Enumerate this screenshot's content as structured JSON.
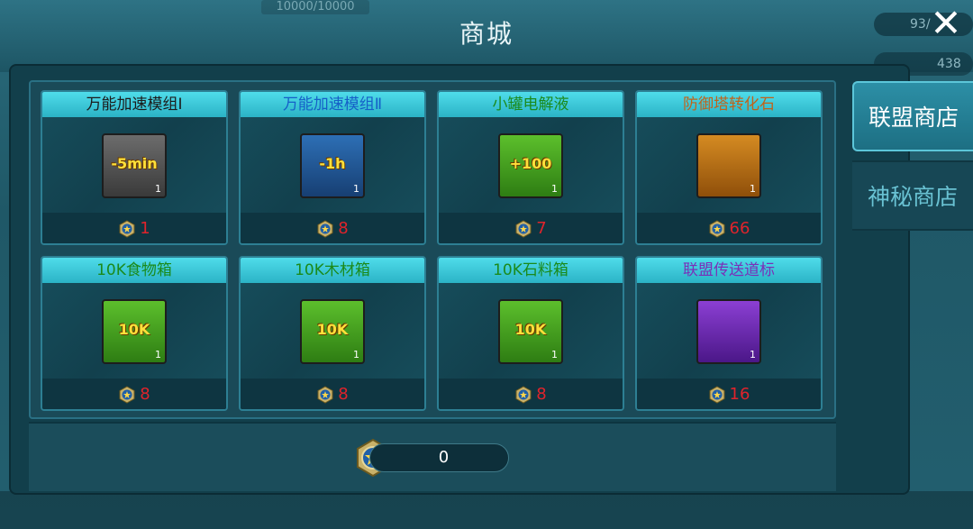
{
  "header": {
    "title": "商城",
    "close_icon": "close-icon"
  },
  "background": {
    "resource_text": "10000/10000",
    "res2": "93/",
    "res3": "438"
  },
  "tabs": [
    {
      "label": "联盟商店",
      "active": true
    },
    {
      "label": "神秘商店",
      "active": false
    }
  ],
  "items": [
    {
      "name": "万能加速模组Ⅰ",
      "name_color": "#1c1c1c",
      "icon": "speedup-module-icon",
      "badge": "-5min",
      "frame": "gray",
      "qty": "1",
      "price": "1"
    },
    {
      "name": "万能加速模组Ⅱ",
      "name_color": "#1560c8",
      "icon": "speedup-module-icon",
      "badge": "-1h",
      "frame": "blue",
      "qty": "1",
      "price": "8"
    },
    {
      "name": "小罐电解液",
      "name_color": "#1b8a1b",
      "icon": "electrolyte-can-icon",
      "badge": "+100",
      "frame": "green",
      "qty": "1",
      "price": "7"
    },
    {
      "name": "防御塔转化石",
      "name_color": "#c0631a",
      "icon": "conversion-stone-icon",
      "badge": "",
      "frame": "orange",
      "qty": "1",
      "price": "66"
    },
    {
      "name": "10K食物箱",
      "name_color": "#1b8a1b",
      "icon": "food-chest-icon",
      "badge": "10K",
      "frame": "green",
      "qty": "1",
      "price": "8"
    },
    {
      "name": "10K木材箱",
      "name_color": "#1b8a1b",
      "icon": "wood-chest-icon",
      "badge": "10K",
      "frame": "green",
      "qty": "1",
      "price": "8"
    },
    {
      "name": "10K石料箱",
      "name_color": "#1b8a1b",
      "icon": "stone-chest-icon",
      "badge": "10K",
      "frame": "green",
      "qty": "1",
      "price": "8"
    },
    {
      "name": "联盟传送道标",
      "name_color": "#7a2fb8",
      "icon": "teleport-beacon-icon",
      "badge": "",
      "frame": "purple",
      "qty": "1",
      "price": "16"
    }
  ],
  "currency": {
    "icon": "alliance-coin-icon",
    "amount": "0"
  }
}
